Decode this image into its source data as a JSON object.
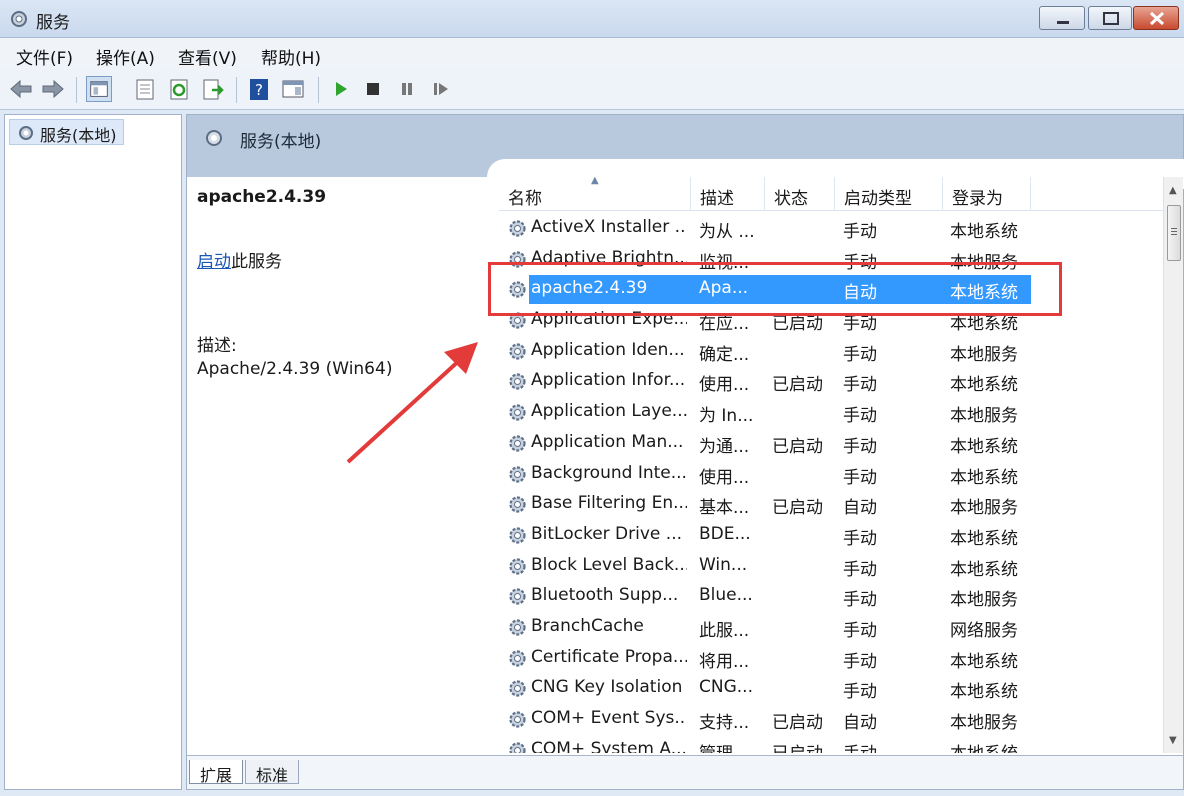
{
  "window": {
    "title": "服务"
  },
  "menu": [
    {
      "label": "文件(F)"
    },
    {
      "label": "操作(A)"
    },
    {
      "label": "查看(V)"
    },
    {
      "label": "帮助(H)"
    }
  ],
  "toolbar": {
    "icons": [
      "back-arrow-icon",
      "forward-arrow-icon",
      "show-tree-icon",
      "properties-icon",
      "refresh-icon",
      "export-list-icon",
      "help-icon",
      "action-pane-icon",
      "start-service-icon",
      "stop-service-icon",
      "pause-service-icon",
      "restart-service-icon"
    ]
  },
  "tree": {
    "root_label": "服务(本地)"
  },
  "main": {
    "header_title": "服务(本地)",
    "details": {
      "service_name": "apache2.4.39",
      "start_link": "启动",
      "start_suffix": "此服务",
      "desc_label": "描述:",
      "desc_text": "Apache/2.4.39 (Win64)"
    },
    "columns": [
      "名称",
      "描述",
      "状态",
      "启动类型",
      "登录为"
    ],
    "services": [
      {
        "name": "ActiveX Installer ...",
        "desc": "为从 ...",
        "status": "",
        "startup": "手动",
        "logon": "本地系统"
      },
      {
        "name": "Adaptive Brightn...",
        "desc": "监视...",
        "status": "",
        "startup": "手动",
        "logon": "本地服务"
      },
      {
        "name": "apache2.4.39",
        "desc": "Apa...",
        "status": "",
        "startup": "自动",
        "logon": "本地系统",
        "selected": true
      },
      {
        "name": "Application Expe...",
        "desc": "在应...",
        "status": "已启动",
        "startup": "手动",
        "logon": "本地系统"
      },
      {
        "name": "Application Iden...",
        "desc": "确定...",
        "status": "",
        "startup": "手动",
        "logon": "本地服务"
      },
      {
        "name": "Application Infor...",
        "desc": "使用...",
        "status": "已启动",
        "startup": "手动",
        "logon": "本地系统"
      },
      {
        "name": "Application Laye...",
        "desc": "为 In...",
        "status": "",
        "startup": "手动",
        "logon": "本地服务"
      },
      {
        "name": "Application Man...",
        "desc": "为通...",
        "status": "已启动",
        "startup": "手动",
        "logon": "本地系统"
      },
      {
        "name": "Background Inte...",
        "desc": "使用...",
        "status": "",
        "startup": "手动",
        "logon": "本地系统"
      },
      {
        "name": "Base Filtering En...",
        "desc": "基本...",
        "status": "已启动",
        "startup": "自动",
        "logon": "本地服务"
      },
      {
        "name": "BitLocker Drive ...",
        "desc": "BDE...",
        "status": "",
        "startup": "手动",
        "logon": "本地系统"
      },
      {
        "name": "Block Level Back...",
        "desc": "Win...",
        "status": "",
        "startup": "手动",
        "logon": "本地系统"
      },
      {
        "name": "Bluetooth Supp...",
        "desc": "Blue...",
        "status": "",
        "startup": "手动",
        "logon": "本地服务"
      },
      {
        "name": "BranchCache",
        "desc": "此服...",
        "status": "",
        "startup": "手动",
        "logon": "网络服务"
      },
      {
        "name": "Certificate Propa...",
        "desc": "将用...",
        "status": "",
        "startup": "手动",
        "logon": "本地系统"
      },
      {
        "name": "CNG Key Isolation",
        "desc": "CNG...",
        "status": "",
        "startup": "手动",
        "logon": "本地系统"
      },
      {
        "name": "COM+ Event Sys...",
        "desc": "支持...",
        "status": "已启动",
        "startup": "自动",
        "logon": "本地服务"
      },
      {
        "name": "COM+ System A...",
        "desc": "管理...",
        "status": "已启动",
        "startup": "手动",
        "logon": "本地系统"
      }
    ]
  },
  "tabs": [
    {
      "label": "扩展",
      "active": true
    },
    {
      "label": "标准",
      "active": false
    }
  ],
  "colors": {
    "selection": "#3399ff",
    "callout": "#e33a3a",
    "header_band": "#b9c9dd"
  }
}
